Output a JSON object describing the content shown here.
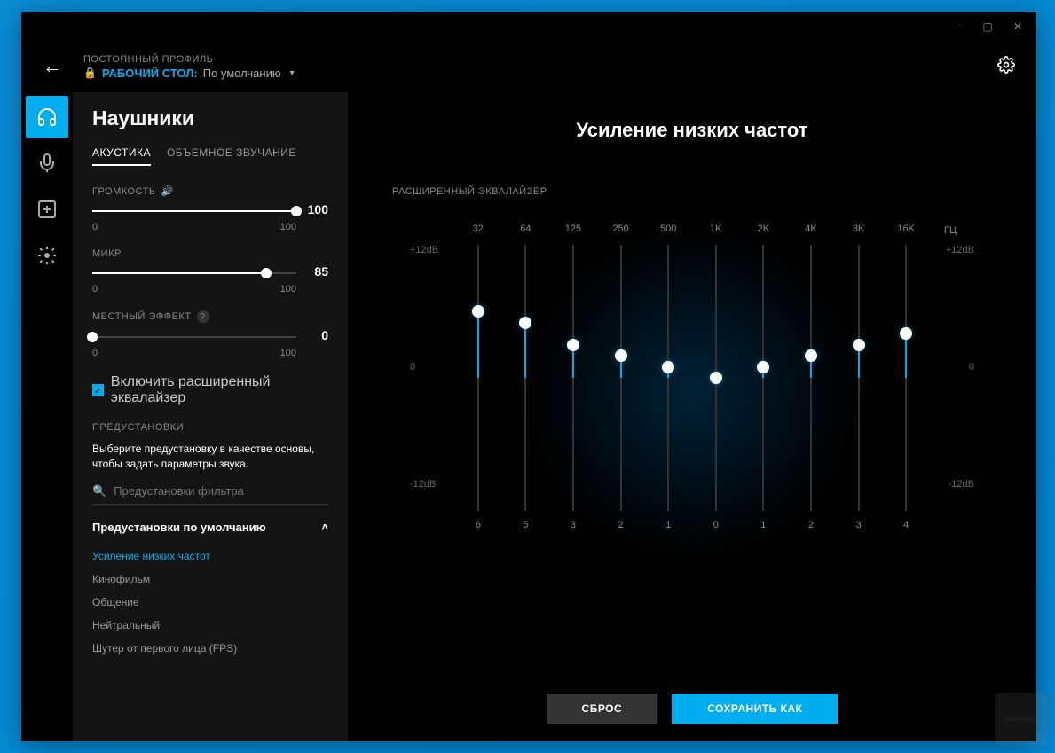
{
  "header": {
    "profile_label": "ПОСТОЯННЫЙ ПРОФИЛЬ",
    "desktop_label": "РАБОЧИЙ СТОЛ:",
    "default_label": "По умолчанию"
  },
  "sidebar": {
    "title": "Наушники",
    "tabs": {
      "acoustics": "АКУСТИКА",
      "surround": "ОБЪЕМНОЕ ЗВУЧАНИЕ"
    },
    "volume": {
      "label": "ГРОМКОСТЬ",
      "value": "100",
      "min": "0",
      "max": "100"
    },
    "mic": {
      "label": "МИКР",
      "value": "85",
      "min": "0",
      "max": "100"
    },
    "sidetone": {
      "label": "МЕСТНЫЙ ЭФФЕКТ",
      "value": "0",
      "min": "0",
      "max": "100"
    },
    "eq_checkbox": "Включить расширенный эквалайзер",
    "presets_label": "ПРЕДУСТАНОВКИ",
    "presets_desc": "Выберите предустановку в качестве основы, чтобы задать параметры звука.",
    "search_placeholder": "Предустановки фильтра",
    "presets_header": "Предустановки по умолчанию",
    "presets": {
      "p0": "Усиление низких частот",
      "p1": "Кинофильм",
      "p2": "Общение",
      "p3": "Нейтральный",
      "p4": "Шутер от первого лица (FPS)"
    }
  },
  "main": {
    "title": "Усиление низких частот",
    "eq_label": "РАСШИРЕННЫЙ ЭКВАЛАЙЗЕР",
    "hz_label": "ГЦ",
    "db_top": "+12dB",
    "db_mid": "0",
    "db_bot": "-12dB",
    "bands": {
      "b0": {
        "freq": "32",
        "val": "6"
      },
      "b1": {
        "freq": "64",
        "val": "5"
      },
      "b2": {
        "freq": "125",
        "val": "3"
      },
      "b3": {
        "freq": "250",
        "val": "2"
      },
      "b4": {
        "freq": "500",
        "val": "1"
      },
      "b5": {
        "freq": "1K",
        "val": "0"
      },
      "b6": {
        "freq": "2K",
        "val": "1"
      },
      "b7": {
        "freq": "4K",
        "val": "2"
      },
      "b8": {
        "freq": "8K",
        "val": "3"
      },
      "b9": {
        "freq": "16K",
        "val": "4"
      }
    },
    "reset": "СБРОС",
    "save": "СОХРАНИТЬ КАК"
  },
  "chart_data": {
    "type": "bar",
    "title": "Усиление низких частот — Расширенный эквалайзер",
    "xlabel": "ГЦ",
    "ylabel": "dB",
    "ylim": [
      -12,
      12
    ],
    "categories": [
      "32",
      "64",
      "125",
      "250",
      "500",
      "1K",
      "2K",
      "4K",
      "8K",
      "16K"
    ],
    "values": [
      6,
      5,
      3,
      2,
      1,
      0,
      1,
      2,
      3,
      4
    ]
  }
}
